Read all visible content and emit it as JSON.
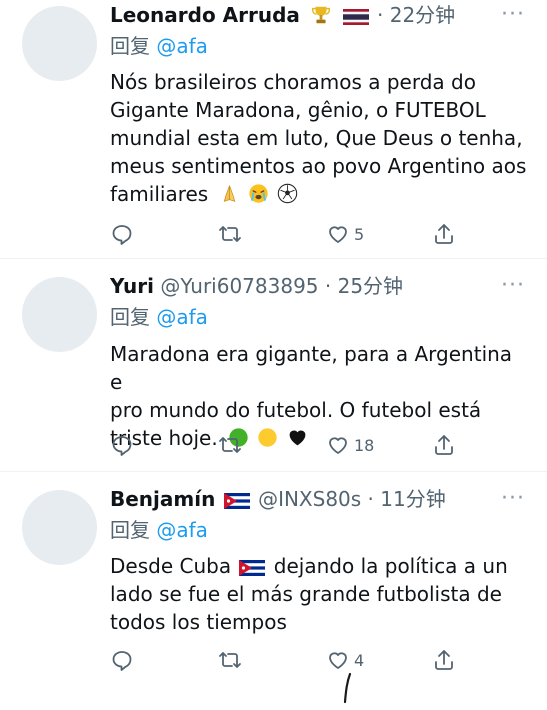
{
  "replies": [
    {
      "name": "Leonardo Arruda",
      "handle": "",
      "time": "22分钟",
      "badges": [
        "trophy-icon",
        "thailand-flag-icon"
      ],
      "reply_prefix": "回复",
      "reply_to": "@afa",
      "text": "Nós brasileiros choramos a perda do Gigante Maradona, gênio, o FUTEBOL mundial esta em luto, Que Deus o tenha, meus sentimentos ao povo Argentino aos familiares",
      "text_lines": [
        "Nós brasileiros choramos a perda do",
        "Gigante Maradona, gênio, o FUTEBOL",
        "mundial esta em luto, Que Deus o tenha,",
        "meus sentimentos ao povo Argentino aos",
        "familiares"
      ],
      "emojis": [
        "folded-hands-icon",
        "crying-face-icon",
        "soccer-ball-icon"
      ],
      "like_count": "5"
    },
    {
      "name": "Yuri",
      "handle": "@Yuri60783895",
      "time": "25分钟",
      "reply_prefix": "回复",
      "reply_to": "@afa",
      "text_lines": [
        "Maradona era gigante, para a Argentina e",
        "pro mundo do futebol. O futebol está",
        "triste hoje."
      ],
      "emojis": [
        "green-circle-icon",
        "yellow-circle-icon",
        "black-heart-icon"
      ],
      "like_count": "18"
    },
    {
      "name": "Benjamín",
      "handle": "@INXS80s",
      "time": "11分钟",
      "reply_prefix": "回复",
      "reply_to": "@afa",
      "text_line1_before_flag": "Desde Cuba",
      "text_line1_after_flag": "dejando la política a un",
      "text_lines_rest": [
        "lado se fue el más grande futbolista de",
        "todos los tiempos"
      ],
      "like_count": "4"
    }
  ],
  "separator": "·",
  "more_label": "···",
  "colors": {
    "text": "#0f1419",
    "secondary": "#536471",
    "accent": "#1d9bf0",
    "avatar": "#e6ecf0",
    "divider": "#eff3f4"
  }
}
